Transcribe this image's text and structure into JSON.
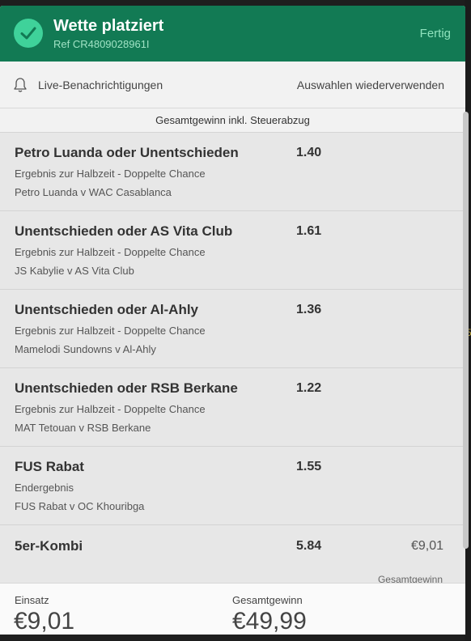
{
  "header": {
    "title": "Wette platziert",
    "ref": "Ref CR4809028961I",
    "done_label": "Fertig"
  },
  "options": {
    "live_label": "Live-Benachrichtigungen",
    "reuse_label": "Auswahlen wiederverwenden"
  },
  "subheader": "Gesamtgewinn inkl. Steuerabzug",
  "selections": [
    {
      "name": "Petro Luanda oder Unentschieden",
      "odds": "1.40",
      "market": "Ergebnis zur Halbzeit - Doppelte Chance",
      "event": "Petro Luanda v WAC Casablanca"
    },
    {
      "name": "Unentschieden oder AS Vita Club",
      "odds": "1.61",
      "market": "Ergebnis zur Halbzeit - Doppelte Chance",
      "event": "JS Kabylie v AS Vita Club"
    },
    {
      "name": "Unentschieden oder Al-Ahly",
      "odds": "1.36",
      "market": "Ergebnis zur Halbzeit - Doppelte Chance",
      "event": "Mamelodi Sundowns v Al-Ahly"
    },
    {
      "name": "Unentschieden oder RSB Berkane",
      "odds": "1.22",
      "market": "Ergebnis zur Halbzeit - Doppelte Chance",
      "event": "MAT Tetouan v RSB Berkane"
    },
    {
      "name": "FUS Rabat",
      "odds": "1.55",
      "market": "Endergebnis",
      "event": "FUS Rabat v OC Khouribga"
    }
  ],
  "kombi": {
    "name": "5er-Kombi",
    "odds": "5.84",
    "stake": "€9,01",
    "cut_text": "Gesamtgewinn"
  },
  "footer": {
    "stake_label": "Einsatz",
    "stake_value": "€9,01",
    "win_label": "Gesamtgewinn",
    "win_value": "€49,99"
  },
  "colors": {
    "header_bg": "#127a54",
    "check_bg": "#3fd29a",
    "done_text": "#8fe2bd"
  },
  "icons": {
    "check": "check-icon",
    "bell": "bell-icon"
  }
}
